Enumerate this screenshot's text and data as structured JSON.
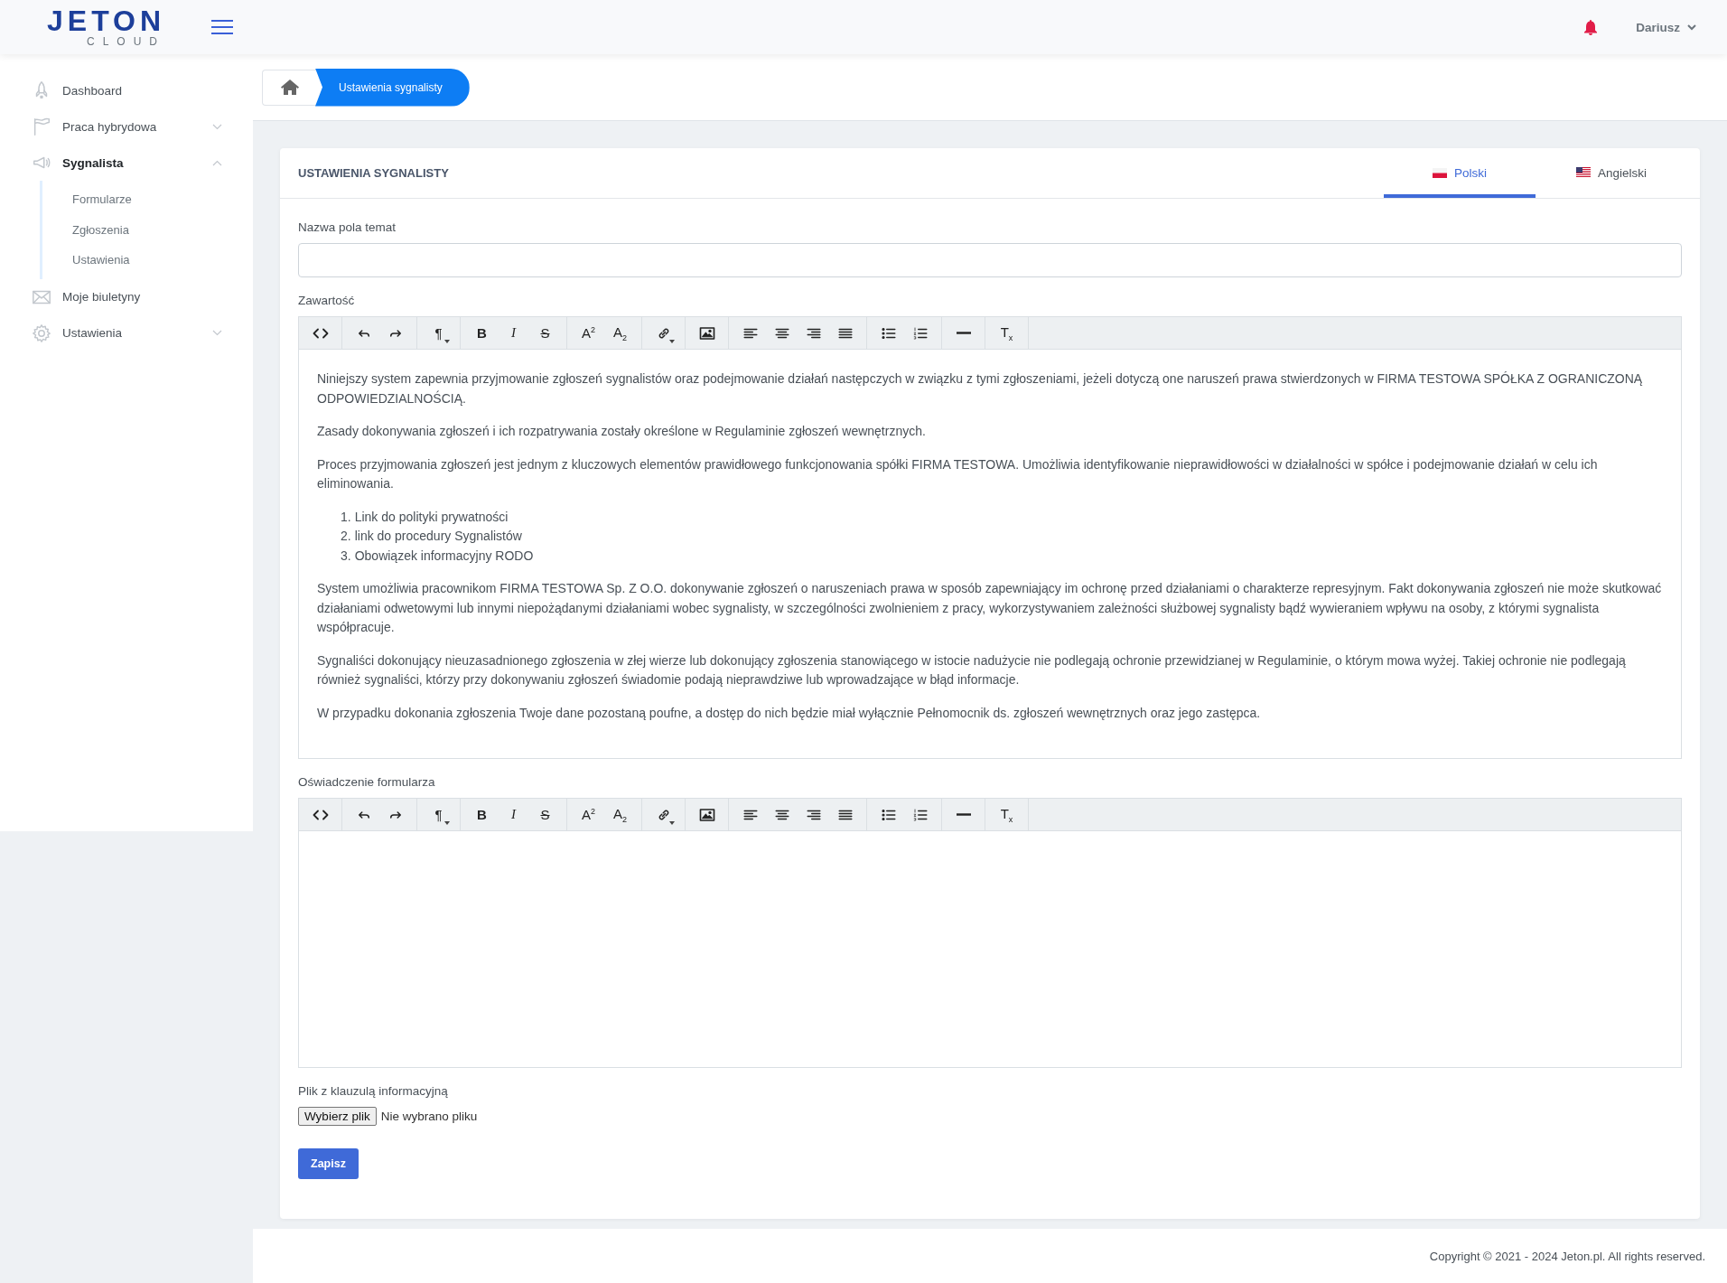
{
  "header": {
    "logo_main": "JETON",
    "logo_sub": "CLOUD",
    "user": "Dariusz"
  },
  "sidebar": {
    "items": [
      {
        "label": "Dashboard",
        "kind": "link",
        "selected": false
      },
      {
        "label": "Praca hybrydowa",
        "kind": "group",
        "selected": false,
        "expanded": false
      },
      {
        "label": "Sygnalista",
        "kind": "group",
        "selected": true,
        "expanded": true,
        "children": [
          {
            "label": "Formularze",
            "selected": false
          },
          {
            "label": "Zgłoszenia",
            "selected": false
          },
          {
            "label": "Ustawienia",
            "selected": false
          }
        ]
      },
      {
        "label": "Moje biuletyny",
        "kind": "link",
        "selected": false
      },
      {
        "label": "Ustawienia",
        "kind": "group",
        "selected": false,
        "expanded": false
      }
    ]
  },
  "breadcrumb": {
    "current": "Ustawienia sygnalisty"
  },
  "card": {
    "title": "USTAWIENIA SYGNALISTY",
    "tabs": [
      {
        "label": "Polski",
        "kind": "pl",
        "selected": true
      },
      {
        "label": "Angielski",
        "kind": "us",
        "selected": false
      }
    ],
    "subject_field": {
      "label": "Nazwa pola temat"
    },
    "editors": [
      {
        "label": "Zawartość",
        "toolbar": [
          [
            {
              "kind": "code"
            }
          ],
          [
            {
              "kind": "undo"
            },
            {
              "kind": "redo"
            }
          ],
          [
            {
              "kind": "paragraph",
              "glyph": "¶"
            }
          ],
          [
            {
              "kind": "bold",
              "glyph": "B"
            },
            {
              "kind": "italic",
              "glyph": "I"
            },
            {
              "kind": "strike",
              "glyph": "S"
            }
          ],
          [
            {
              "kind": "superscript",
              "glyph": "A",
              "small": "2"
            },
            {
              "kind": "subscript",
              "glyph": "A",
              "small": "2"
            }
          ],
          [
            {
              "kind": "link"
            }
          ],
          [
            {
              "kind": "image"
            }
          ],
          [
            {
              "kind": "align-left"
            },
            {
              "kind": "align-center"
            },
            {
              "kind": "align-right"
            },
            {
              "kind": "justify"
            }
          ],
          [
            {
              "kind": "bullet-list"
            },
            {
              "kind": "numbered-list"
            }
          ],
          [
            {
              "kind": "rule"
            }
          ],
          [
            {
              "kind": "clear",
              "glyph": "T",
              "small": "x"
            }
          ]
        ],
        "blocks": [
          {
            "kind": "paragraph",
            "text": "Niniejszy system zapewnia przyjmowanie zgłoszeń sygnalistów oraz podejmowanie działań następczych w związku z tymi zgłoszeniami, jeżeli dotyczą one naruszeń prawa stwierdzonych w FIRMA TESTOWA SPÓŁKA Z OGRANICZONĄ ODPOWIEDZIALNOŚCIĄ."
          },
          {
            "kind": "paragraph",
            "text": "Zasady dokonywania zgłoszeń i ich rozpatrywania zostały określone w Regulaminie zgłoszeń wewnętrznych."
          },
          {
            "kind": "paragraph",
            "text": "Proces przyjmowania zgłoszeń jest jednym z kluczowych elementów prawidłowego funkcjonowania spółki FIRMA TESTOWA. Umożliwia identyfikowanie nieprawidłowości w działalności w spółce  i podejmowanie działań w celu ich eliminowania."
          },
          {
            "kind": "list",
            "items": [
              {
                "number": "1.",
                "text": "Link do polityki prywatności"
              },
              {
                "number": "2.",
                "text": "link do procedury Sygnalistów"
              },
              {
                "number": "3.",
                "text": "Obowiązek informacyjny RODO"
              }
            ]
          },
          {
            "kind": "paragraph",
            "text": "System umożliwia pracownikom FIRMA TESTOWA Sp. Z O.O. dokonywanie zgłoszeń o naruszeniach prawa w sposób zapewniający im ochronę przed działaniami o charakterze represyjnym. Fakt dokonywania zgłoszeń nie może skutkować działaniami odwetowymi lub innymi niepożądanymi działaniami wobec sygnalisty, w szczególności zwolnieniem z pracy, wykorzystywaniem zależności służbowej sygnalisty bądź wywieraniem wpływu na osoby, z którymi sygnalista współpracuje."
          },
          {
            "kind": "paragraph",
            "text": "Sygnaliści dokonujący nieuzasadnionego zgłoszenia w złej wierze lub dokonujący zgłoszenia stanowiącego w istocie nadużycie nie podlegają ochronie przewidzianej w Regulaminie, o którym mowa wyżej. Takiej ochronie nie podlegają również sygnaliści, którzy przy dokonywaniu zgłoszeń świadomie podają nieprawdziwe lub wprowadzające w błąd informacje."
          },
          {
            "kind": "paragraph",
            "text": "W przypadku dokonania zgłoszenia Twoje dane pozostaną poufne, a dostęp do nich będzie miał wyłącznie Pełnomocnik ds. zgłoszeń wewnętrznych oraz jego zastępca."
          }
        ]
      },
      {
        "label": "Oświadczenie formularza",
        "toolbar": [
          [
            {
              "kind": "code"
            }
          ],
          [
            {
              "kind": "undo"
            },
            {
              "kind": "redo"
            }
          ],
          [
            {
              "kind": "paragraph",
              "glyph": "¶"
            }
          ],
          [
            {
              "kind": "bold",
              "glyph": "B"
            },
            {
              "kind": "italic",
              "glyph": "I"
            },
            {
              "kind": "strike",
              "glyph": "S"
            }
          ],
          [
            {
              "kind": "superscript",
              "glyph": "A",
              "small": "2"
            },
            {
              "kind": "subscript",
              "glyph": "A",
              "small": "2"
            }
          ],
          [
            {
              "kind": "link"
            }
          ],
          [
            {
              "kind": "image"
            }
          ],
          [
            {
              "kind": "align-left"
            },
            {
              "kind": "align-center"
            },
            {
              "kind": "align-right"
            },
            {
              "kind": "justify"
            }
          ],
          [
            {
              "kind": "bullet-list"
            },
            {
              "kind": "numbered-list"
            }
          ],
          [
            {
              "kind": "rule"
            }
          ],
          [
            {
              "kind": "clear",
              "glyph": "T",
              "small": "x"
            }
          ]
        ]
      }
    ],
    "file_field": {
      "label": "Plik z klauzulą informacyjną",
      "button": "Wybierz plik",
      "status": "Nie wybrano pliku"
    },
    "save_button": "Zapisz"
  },
  "footer": "Copyright © 2021 - 2024 Jeton.pl. All rights reserved."
}
